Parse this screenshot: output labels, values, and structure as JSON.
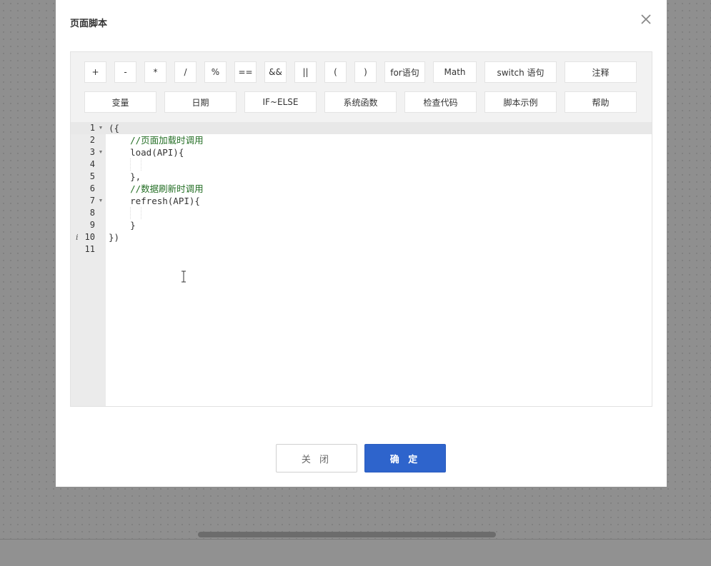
{
  "dialog": {
    "title": "页面脚本",
    "close_icon": "close-icon"
  },
  "toolbar": {
    "row1": [
      "+",
      "-",
      "*",
      "/",
      "%",
      "==",
      "&&",
      "||",
      "(",
      ")",
      "for语句",
      "Math",
      "switch 语句",
      "注释"
    ],
    "row2": [
      "变量",
      "日期",
      "IF~ELSE",
      "系统函数",
      "检查代码",
      "脚本示例",
      "帮助"
    ]
  },
  "editor": {
    "line_numbers": [
      "1",
      "2",
      "3",
      "4",
      "5",
      "6",
      "7",
      "8",
      "9",
      "10",
      "11"
    ],
    "fold_icon": "fold-arrow-icon",
    "info_marker": "i",
    "lines": [
      "({",
      "    //页面加载时调用",
      "    load(API){",
      "",
      "    },",
      "    //数据刷新时调用",
      "    refresh(API){",
      "",
      "    }",
      "})",
      ""
    ]
  },
  "footer": {
    "close_label": "关 闭",
    "confirm_label": "确 定"
  },
  "colors": {
    "primary": "#2e64cc",
    "comment": "#236e24",
    "overlay": "#8f8f8f"
  }
}
